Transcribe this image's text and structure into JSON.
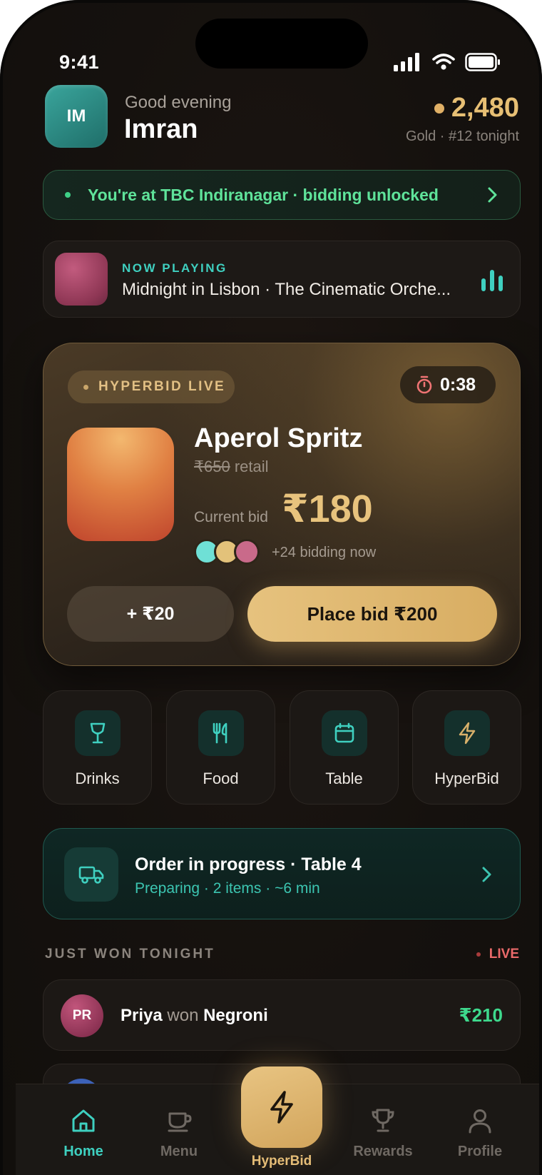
{
  "status_bar": {
    "time": "9:41"
  },
  "header": {
    "avatar_initials": "IM",
    "greeting": "Good evening",
    "name": "Imran",
    "points": "2,480",
    "tier": "Gold · #12 tonight"
  },
  "location_banner": {
    "text": "You're at TBC Indiranagar · bidding unlocked"
  },
  "now_playing": {
    "label": "NOW PLAYING",
    "title": "Midnight in Lisbon · The Cinematic Orche..."
  },
  "hyperbid": {
    "live_label": "HYPERBID LIVE",
    "timer": "0:38",
    "item_name": "Aperol Spritz",
    "retail_price": "₹650",
    "retail_suffix": "retail",
    "current_bid_label": "Current bid",
    "current_bid": "₹180",
    "bidders_text": "+24 bidding now",
    "bidder_colors": [
      "#6fe0d6",
      "#e3c27a",
      "#c96a8a"
    ],
    "increment_button": "+ ₹20",
    "place_bid_button": "Place bid ₹200"
  },
  "quick_actions": [
    {
      "label": "Drinks",
      "icon": "wine-glass-icon"
    },
    {
      "label": "Food",
      "icon": "cutlery-icon"
    },
    {
      "label": "Table",
      "icon": "calendar-icon"
    },
    {
      "label": "HyperBid",
      "icon": "lightning-icon"
    }
  ],
  "order": {
    "title": "Order in progress · Table 4",
    "subtitle": "Preparing · 2 items · ~6 min"
  },
  "just_won": {
    "heading": "JUST WON TONIGHT",
    "live_label": "LIVE",
    "entries": [
      {
        "initials": "PR",
        "name": "Priya",
        "verb": "won",
        "item": "Negroni",
        "amount": "₹210"
      }
    ]
  },
  "tabbar": {
    "home": "Home",
    "menu": "Menu",
    "hyperbid": "HyperBid",
    "rewards": "Rewards",
    "profile": "Profile"
  },
  "colors": {
    "accent_teal": "#3ed0c0",
    "accent_gold": "#e3bd78",
    "success_green": "#3ed98d",
    "live_red": "#ea6a6a"
  }
}
